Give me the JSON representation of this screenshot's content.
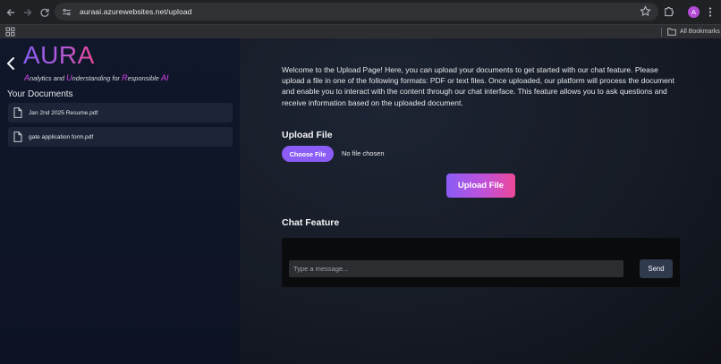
{
  "browser": {
    "url": "auraai.azurewebsites.net/upload",
    "profile_initial": "A",
    "all_bookmarks_label": "All Bookmarks"
  },
  "sidebar": {
    "brand": "AURA",
    "tagline": {
      "parts": [
        {
          "text": "A",
          "highlight": true
        },
        {
          "text": "nalytics and ",
          "highlight": false
        },
        {
          "text": "U",
          "highlight": true
        },
        {
          "text": "nderstanding for ",
          "highlight": false
        },
        {
          "text": "R",
          "highlight": true
        },
        {
          "text": "esponsible ",
          "highlight": false
        },
        {
          "text": "AI",
          "highlight": true
        }
      ]
    },
    "documents_title": "Your Documents",
    "documents": [
      {
        "name": "Jan 2nd 2025 Resume.pdf"
      },
      {
        "name": "gate application form.pdf"
      }
    ]
  },
  "main": {
    "intro": "Welcome to the Upload Page! Here, you can upload your documents to get started with our chat feature. Please upload a file in one of the following formats: PDF or text files. Once uploaded, our platform will process the document and enable you to interact with the content through our chat interface. This feature allows you to ask questions and receive information based on the uploaded document.",
    "upload_heading": "Upload File",
    "choose_file_label": "Choose File",
    "no_file_text": "No file chosen",
    "upload_button": "Upload File",
    "chat_heading": "Chat Feature",
    "chat_placeholder": "Type a message...",
    "send_button": "Send"
  },
  "colors": {
    "accent_purple": "#8b5cf6",
    "accent_pink": "#ec4899",
    "sidebar_bg": "#10172a"
  }
}
